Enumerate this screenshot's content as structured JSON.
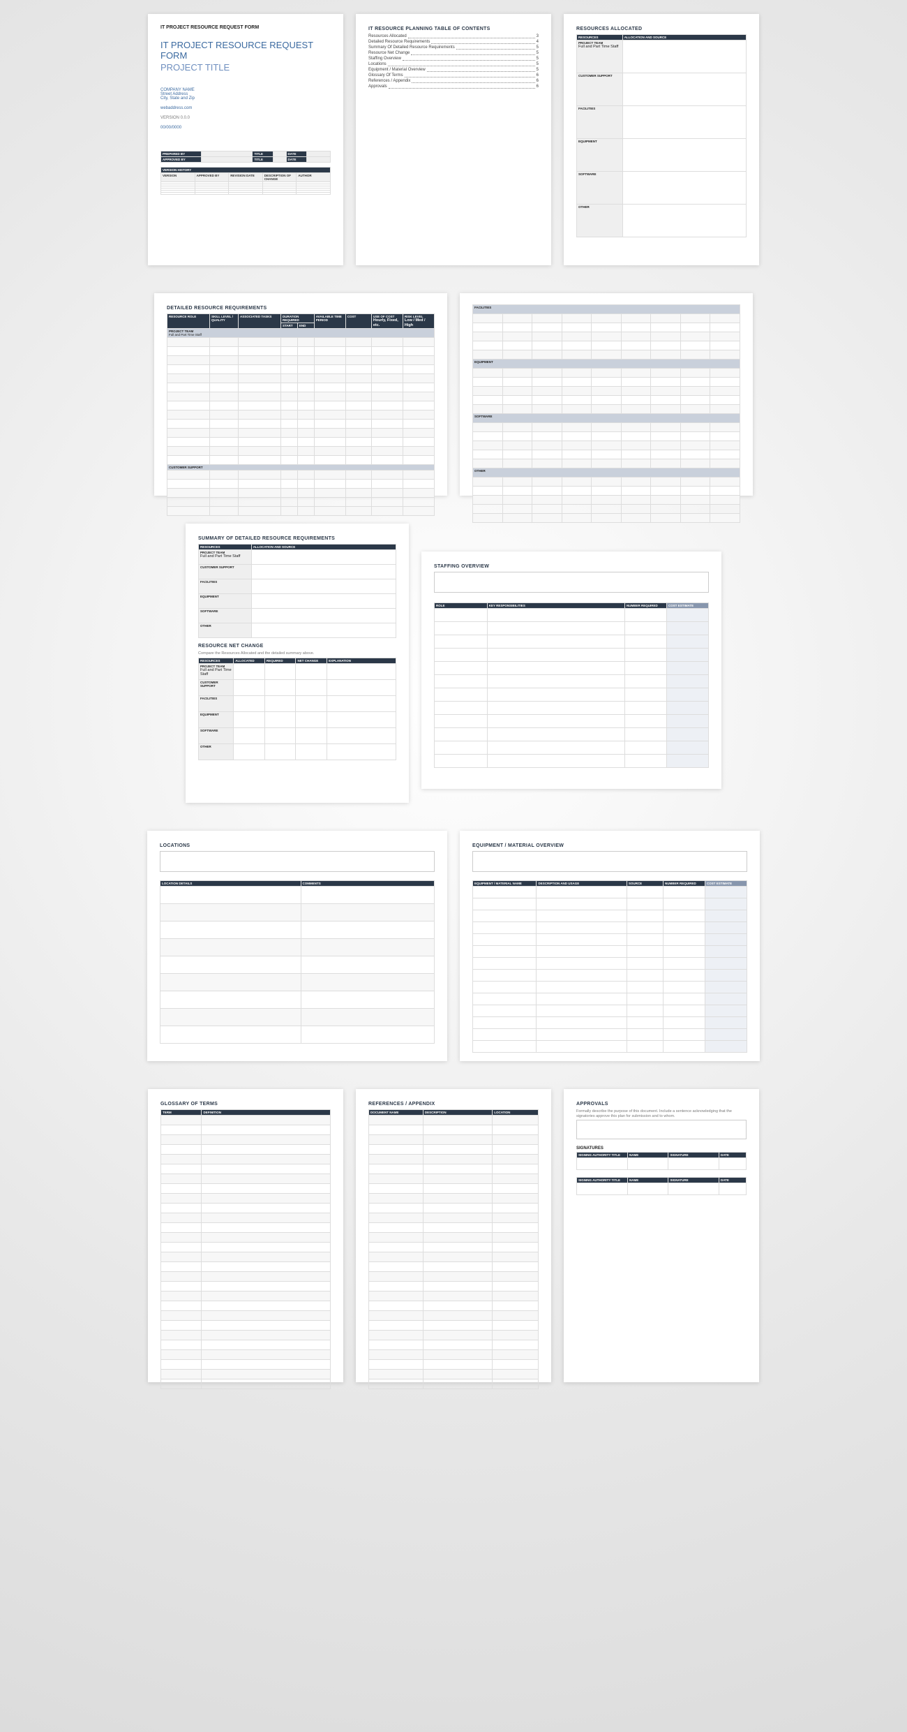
{
  "p1": {
    "header": "IT PROJECT RESOURCE REQUEST FORM",
    "title1": "IT PROJECT RESOURCE REQUEST FORM",
    "title2": "PROJECT TITLE",
    "company": "COMPANY NAME",
    "street": "Street Address",
    "city": "City, State and Zip",
    "web": "webaddress.com",
    "version": "VERSION 0.0.0",
    "date": "00/00/0000",
    "tbl1": {
      "c1": "PREPARED BY",
      "c2": "TITLE",
      "c3": "DATE",
      "c4": "APPROVED BY",
      "c5": "TITLE",
      "c6": "DATE"
    },
    "vh": "VERSION HISTORY",
    "vh_cols": {
      "c1": "VERSION",
      "c2": "APPROVED BY",
      "c3": "REVISION DATE",
      "c4": "DESCRIPTION OF CHANGE",
      "c5": "AUTHOR"
    }
  },
  "p2": {
    "title": "IT RESOURCE PLANNING TABLE OF CONTENTS",
    "items": [
      {
        "name": "Resources Allocated",
        "pg": "3"
      },
      {
        "name": "Detailed Resource Requirements",
        "pg": "4"
      },
      {
        "name": "Summary Of Detailed Resource Requirements",
        "pg": "5"
      },
      {
        "name": "Resource Net Change",
        "pg": "5"
      },
      {
        "name": "Staffing Overview",
        "pg": "5"
      },
      {
        "name": "Locations",
        "pg": "5"
      },
      {
        "name": "Equipment / Material Overview",
        "pg": "5"
      },
      {
        "name": "Glossary Of Terms",
        "pg": "6"
      },
      {
        "name": "References / Appendix",
        "pg": "6"
      },
      {
        "name": "Approvals",
        "pg": "6"
      }
    ]
  },
  "p3": {
    "title": "RESOURCES ALLOCATED",
    "c1": "RESOURCES",
    "c2": "ALLOCATION AND SOURCE",
    "rows": [
      {
        "r": "PROJECT TEAM",
        "sub": "Full and Part Time Staff"
      },
      {
        "r": "CUSTOMER SUPPORT"
      },
      {
        "r": "FACILITIES"
      },
      {
        "r": "EQUIPMENT"
      },
      {
        "r": "SOFTWARE"
      },
      {
        "r": "OTHER"
      }
    ]
  },
  "p4": {
    "title": "DETAILED RESOURCE REQUIREMENTS",
    "cols": {
      "c1": "RESOURCE ROLE",
      "c2": "SKILL LEVEL / QUALITY",
      "c3": "ASSOCIATED TASKS",
      "c4": "DURATION REQUIRED",
      "c5": "AVAILABLE TIME PERIOD",
      "c6": "COST",
      "c7": "USE OF COST",
      "c7s": "Hourly, Fixed, etc.",
      "c8": "RISK LEVEL",
      "c8s": "Low / Med / High",
      "c4a": "START",
      "c4b": "END"
    },
    "sub1": "PROJECT TEAM",
    "sub1s": "Full and Part Time Staff",
    "sub2": "CUSTOMER SUPPORT"
  },
  "p5": {
    "subs": [
      "FACILITIES",
      "EQUIPMENT",
      "SOFTWARE",
      "OTHER"
    ]
  },
  "p6": {
    "t1": "SUMMARY OF DETAILED RESOURCE REQUIREMENTS",
    "c1": "RESOURCES",
    "c2": "ALLOCATION AND SOURCE",
    "rows": [
      {
        "r": "PROJECT TEAM",
        "sub": "Full and Part Time Staff"
      },
      {
        "r": "CUSTOMER SUPPORT"
      },
      {
        "r": "FACILITIES"
      },
      {
        "r": "EQUIPMENT"
      },
      {
        "r": "SOFTWARE"
      },
      {
        "r": "OTHER"
      }
    ],
    "t2": "RESOURCE NET CHANGE",
    "t2s": "Compare the Resources Allocated and the detailed summary above.",
    "cols2": {
      "c1": "RESOURCES",
      "c2": "ALLOCATED",
      "c3": "REQUIRED",
      "c4": "NET CHANGE",
      "c5": "EXPLANATION"
    },
    "rows2": [
      {
        "r": "PROJECT TEAM",
        "sub": "Full and Part Time Staff"
      },
      {
        "r": "CUSTOMER SUPPORT"
      },
      {
        "r": "FACILITIES"
      },
      {
        "r": "EQUIPMENT"
      },
      {
        "r": "SOFTWARE"
      },
      {
        "r": "OTHER"
      }
    ]
  },
  "p7": {
    "title": "STAFFING OVERVIEW",
    "cols": {
      "c1": "ROLE",
      "c2": "KEY RESPONSIBILITIES",
      "c3": "NUMBER REQUIRED",
      "c4": "COST ESTIMATE"
    }
  },
  "p8": {
    "title": "LOCATIONS",
    "cols": {
      "c1": "LOCATION DETAILS",
      "c2": "COMMENTS"
    }
  },
  "p9": {
    "title": "EQUIPMENT / MATERIAL OVERVIEW",
    "cols": {
      "c1": "EQUIPMENT / MATERIAL NAME",
      "c2": "DESCRIPTION AND USAGE",
      "c3": "SOURCE",
      "c4": "NUMBER REQUIRED",
      "c5": "COST ESTIMATE"
    }
  },
  "p10": {
    "title": "GLOSSARY OF TERMS",
    "cols": {
      "c1": "TERM",
      "c2": "DEFINITION"
    }
  },
  "p11": {
    "title": "REFERENCES / APPENDIX",
    "cols": {
      "c1": "DOCUMENT NAME",
      "c2": "DESCRIPTION",
      "c3": "LOCATION"
    }
  },
  "p12": {
    "title": "APPROVALS",
    "desc": "Formally describe the purpose of this document. Include a sentence acknowledging that the signatories approve this plan for submission and to whom.",
    "sigs": "SIGNATURES",
    "cols": {
      "c1": "SIGNING AUTHORITY TITLE",
      "c2": "NAME",
      "c3": "SIGNATURE",
      "c4": "DATE"
    }
  }
}
